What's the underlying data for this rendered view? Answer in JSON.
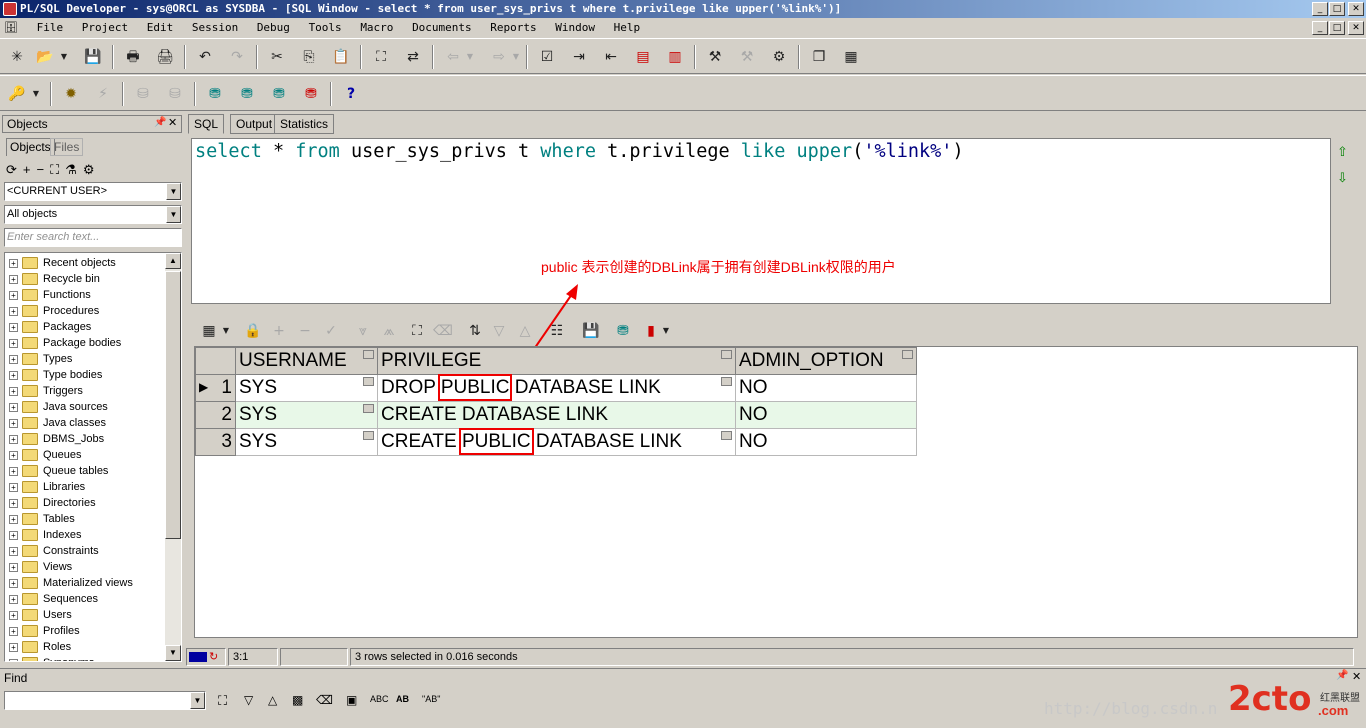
{
  "window": {
    "title": "PL/SQL Developer - sys@ORCL as SYSDBA - [SQL Window - select * from user_sys_privs t where t.privilege like upper('%link%')]"
  },
  "menu": [
    "File",
    "Project",
    "Edit",
    "Session",
    "Debug",
    "Tools",
    "Macro",
    "Documents",
    "Reports",
    "Window",
    "Help"
  ],
  "objects_panel": {
    "title": "Objects",
    "tabs": [
      "Objects",
      "Files"
    ],
    "user_combo": "<CURRENT USER>",
    "filter_combo": "All objects",
    "search_placeholder": "Enter search text...",
    "tree": [
      "Recent objects",
      "Recycle bin",
      "Functions",
      "Procedures",
      "Packages",
      "Package bodies",
      "Types",
      "Type bodies",
      "Triggers",
      "Java sources",
      "Java classes",
      "DBMS_Jobs",
      "Queues",
      "Queue tables",
      "Libraries",
      "Directories",
      "Tables",
      "Indexes",
      "Constraints",
      "Views",
      "Materialized views",
      "Sequences",
      "Users",
      "Profiles",
      "Roles",
      "Synonyms"
    ]
  },
  "sql_window": {
    "tabs": [
      "SQL",
      "Output",
      "Statistics"
    ],
    "sql": {
      "k1": "select",
      "s1": " * ",
      "k2": "from",
      "s2": " user_sys_privs t ",
      "k3": "where",
      "s3": " t.privilege ",
      "k4": "like",
      "s4": " ",
      "k5": "upper",
      "s5": "(",
      "lit": "'%link%'",
      "s6": ")"
    },
    "annotation": "public 表示创建的DBLink属于拥有创建DBLink权限的用户"
  },
  "grid": {
    "columns": [
      "USERNAME",
      "PRIVILEGE",
      "ADMIN_OPTION"
    ],
    "rows": [
      {
        "n": "1",
        "user": "SYS",
        "p1": "DROP ",
        "p2": "PUBLIC",
        "p3": " DATABASE LINK",
        "admin": "NO"
      },
      {
        "n": "2",
        "user": "SYS",
        "p1": "CREATE DATABASE LINK",
        "p2": "",
        "p3": "",
        "admin": "NO"
      },
      {
        "n": "3",
        "user": "SYS",
        "p1": "CREATE ",
        "p2": "PUBLIC",
        "p3": " DATABASE LINK",
        "admin": "NO"
      }
    ],
    "row_colors": {
      "normal": "#ffffff",
      "alternate": "#e8f8e8"
    }
  },
  "status": {
    "position": "3:1",
    "message": "3 rows selected in 0.016 seconds"
  },
  "find": {
    "title": "Find",
    "abc_label": "ABC",
    "ab_label": "AB",
    "quoted_ab_label": "\"AB\""
  },
  "watermark": {
    "url_text": "http://blog.csdn.n",
    "logo": "2cto",
    "logo_suffix": ".com",
    "tag": "红黑联盟"
  },
  "accent": {
    "annotation": "#ee0000",
    "title_start": "#0a246a"
  }
}
